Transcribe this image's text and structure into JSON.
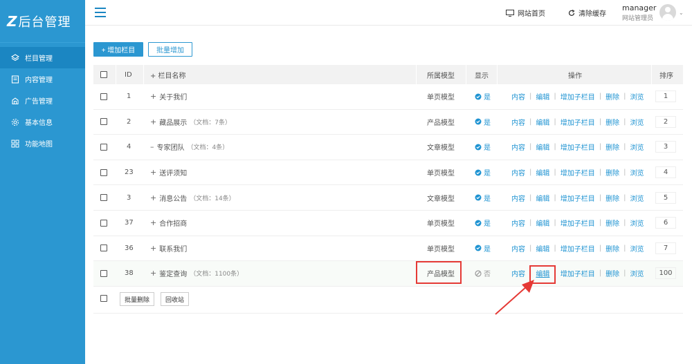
{
  "sidebar": {
    "logo_mark": "Z",
    "logo_text": "后台管理",
    "items": [
      {
        "label": "栏目管理",
        "icon": "layers-icon",
        "active": true
      },
      {
        "label": "内容管理",
        "icon": "document-icon",
        "active": false
      },
      {
        "label": "广告管理",
        "icon": "ad-icon",
        "active": false
      },
      {
        "label": "基本信息",
        "icon": "gear-icon",
        "active": false
      },
      {
        "label": "功能地图",
        "icon": "grid-icon",
        "active": false
      }
    ]
  },
  "topbar": {
    "site_home": "网站首页",
    "clear_cache": "清除缓存",
    "user_name": "manager",
    "user_role": "网站管理员"
  },
  "actions": {
    "add_column": "+ 增加栏目",
    "batch_add": "批量增加",
    "batch_delete": "批量删除",
    "recycle": "回收站"
  },
  "table": {
    "headers": {
      "id": "ID",
      "name": "+ 栏目名称",
      "model": "所属模型",
      "show": "显示",
      "ops": "操作",
      "sort": "排序"
    },
    "op_labels": [
      "内容",
      "编辑",
      "增加子栏目",
      "删除",
      "浏览"
    ],
    "rows": [
      {
        "id": "1",
        "prefix": "+",
        "name": "关于我们",
        "count": "",
        "model": "单页模型",
        "show": "是",
        "sort": "1"
      },
      {
        "id": "2",
        "prefix": "+",
        "name": "藏品展示",
        "count": "（文档：7条）",
        "model": "产品模型",
        "show": "是",
        "sort": "2"
      },
      {
        "id": "4",
        "prefix": "–",
        "name": "专家团队",
        "count": "（文档：4条）",
        "model": "文章模型",
        "show": "是",
        "sort": "3"
      },
      {
        "id": "23",
        "prefix": "+",
        "name": "送评须知",
        "count": "",
        "model": "单页模型",
        "show": "是",
        "sort": "4"
      },
      {
        "id": "3",
        "prefix": "+",
        "name": "消息公告",
        "count": "（文档：14条）",
        "model": "文章模型",
        "show": "是",
        "sort": "5"
      },
      {
        "id": "37",
        "prefix": "+",
        "name": "合作招商",
        "count": "",
        "model": "单页模型",
        "show": "是",
        "sort": "6"
      },
      {
        "id": "36",
        "prefix": "+",
        "name": "联系我们",
        "count": "",
        "model": "单页模型",
        "show": "是",
        "sort": "7"
      },
      {
        "id": "38",
        "prefix": "+",
        "name": "鉴定查询",
        "count": "（文档：1100条）",
        "model": "产品模型",
        "show": "否",
        "sort": "100"
      }
    ]
  },
  "colors": {
    "sidebar_bg": "#2b97d1",
    "link": "#1e93d2",
    "highlight": "#e53935"
  }
}
